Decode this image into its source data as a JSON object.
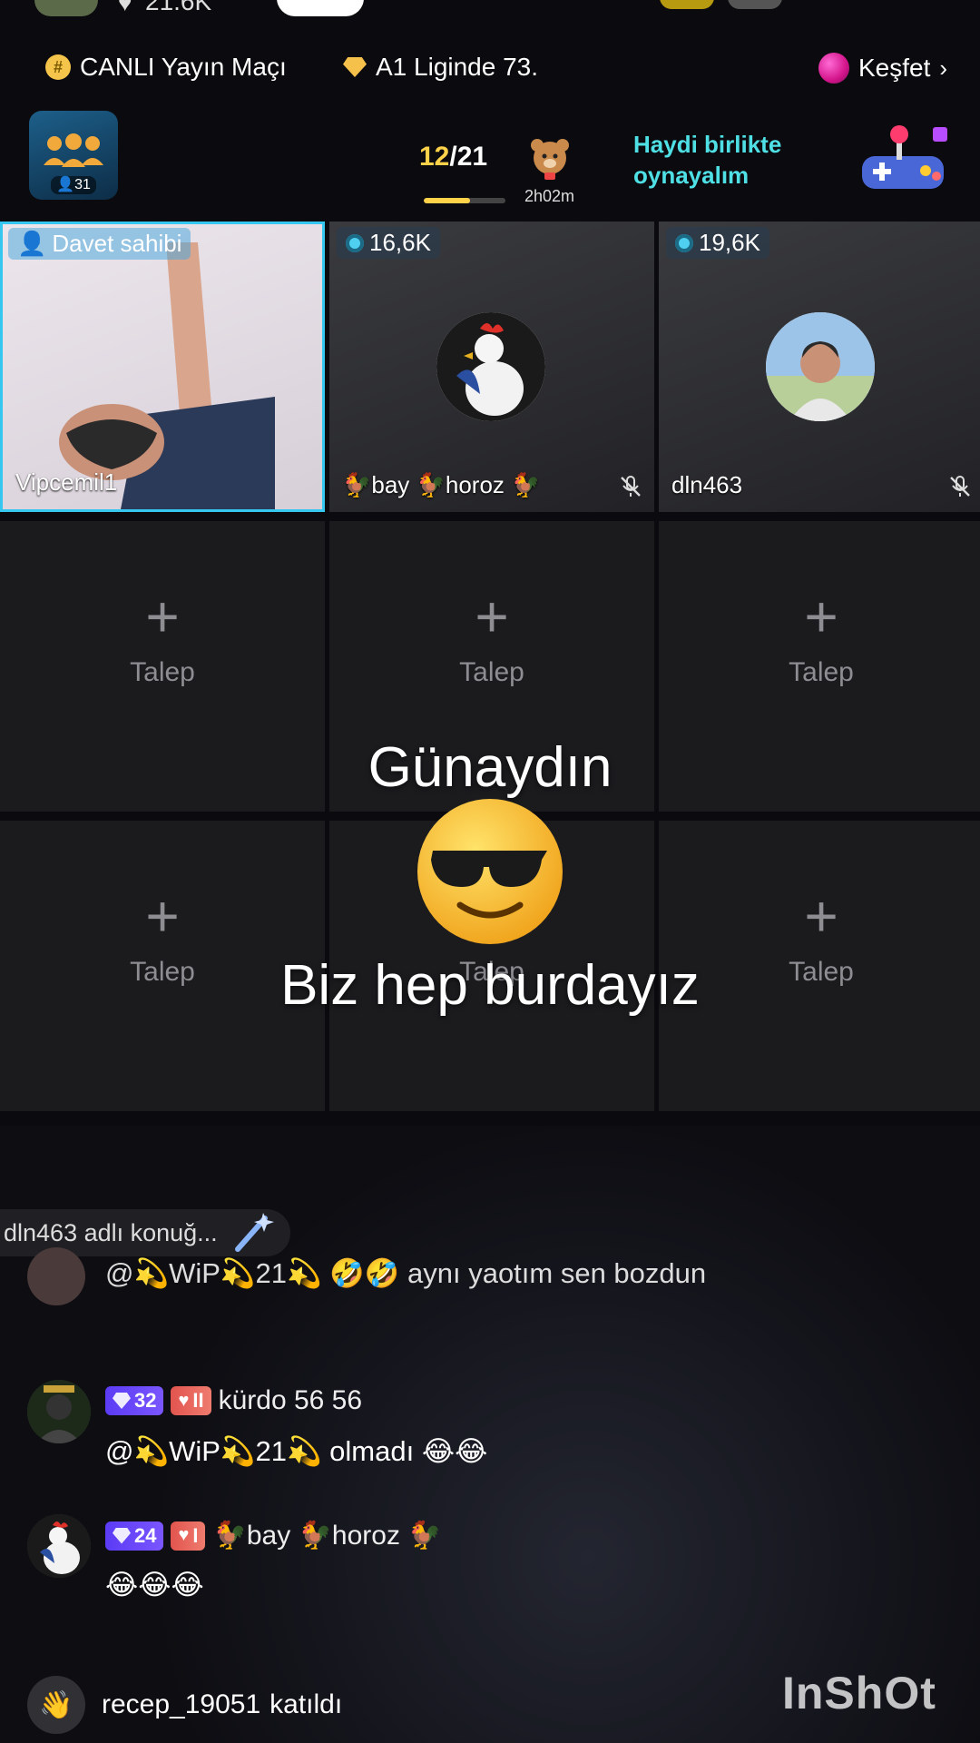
{
  "top_strip": {
    "count": "21.6K"
  },
  "info_bar": {
    "live_match": "CANLI Yayın Maçı",
    "league": "A1 Liginde 73.",
    "explore": "Keşfet"
  },
  "header": {
    "room_members": "31",
    "progress_current": "12",
    "progress_total": "/21",
    "progress_fraction": 0.57,
    "timer": "2h02m",
    "play_together": "Haydi birlikte oynayalım"
  },
  "seats": [
    {
      "badge": "Davet sahibi",
      "name": "Vipcemil1",
      "role": "host"
    },
    {
      "badge": "16,6K",
      "name": "🐓bay 🐓horoz 🐓",
      "muted": true
    },
    {
      "badge": "19,6K",
      "name": "dln463",
      "muted": true
    }
  ],
  "empty_slot_label": "Talep",
  "overlay": {
    "greeting": "Günaydın",
    "tagline": "Biz hep burdayız"
  },
  "chat": {
    "guest_note": "dln463 adlı konuğ...",
    "messages": [
      {
        "text": "@💫WiP💫21💫 🤣🤣 aynı yaotım sen bozdun"
      },
      {
        "level": "32",
        "fan_level": "II",
        "user": "kürdo 56 56",
        "text": "@💫WiP💫21💫 olmadı 😂😂"
      },
      {
        "level": "24",
        "fan_level": "I",
        "user": "🐓bay 🐓horoz 🐓",
        "text": "😂😂😂"
      }
    ],
    "join_user": "recep_19051",
    "join_text": "katıldı"
  },
  "watermark": "InShOt",
  "colors": {
    "accent_cyan": "#4fe0e6",
    "host_border": "#35c7f0",
    "level_badge": "#5b3bf5",
    "fan_badge": "#e2554f",
    "gold": "#ffd24a"
  },
  "icons": [
    "coin-icon",
    "diamond-icon",
    "orb-icon",
    "chevron-right-icon",
    "group-icon",
    "bear-gift-icon",
    "game-controller-icon",
    "plus-icon",
    "mic-off-icon",
    "person-icon",
    "wave-hand-icon"
  ]
}
